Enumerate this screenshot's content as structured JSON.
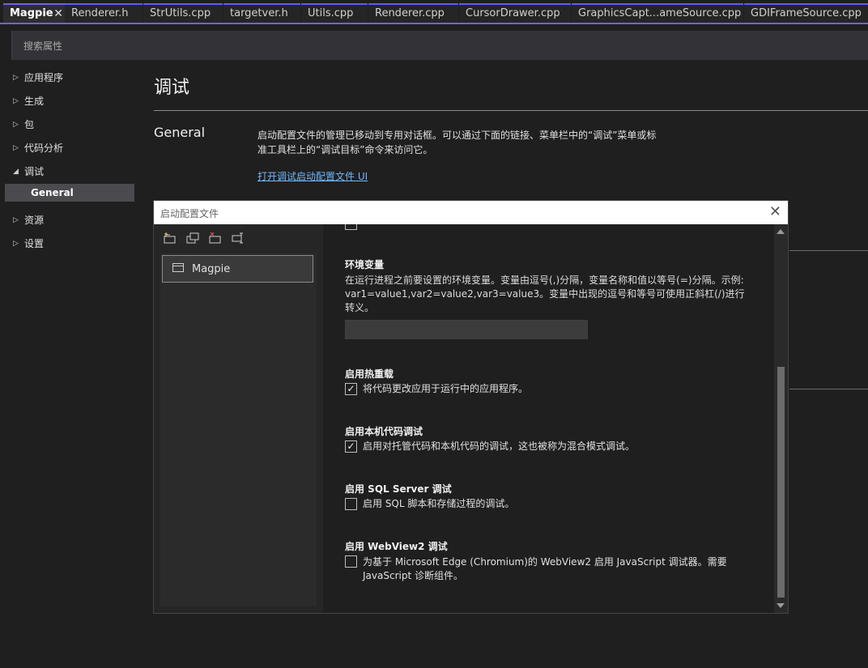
{
  "tabs": [
    {
      "label": "Magpie",
      "active": true
    },
    {
      "label": "Renderer.h"
    },
    {
      "label": "StrUtils.cpp"
    },
    {
      "label": "targetver.h"
    },
    {
      "label": "Utils.cpp"
    },
    {
      "label": "Renderer.cpp"
    },
    {
      "label": "CursorDrawer.cpp"
    },
    {
      "label": "GraphicsCapt...ameSource.cpp"
    },
    {
      "label": "GDIFrameSource.cpp"
    }
  ],
  "tab_close_glyph": "✕",
  "search": {
    "placeholder": "搜索属性"
  },
  "tree": {
    "items": [
      {
        "label": "应用程序",
        "arrow": "▷"
      },
      {
        "label": "生成",
        "arrow": "▷"
      },
      {
        "label": "包",
        "arrow": "▷"
      },
      {
        "label": "代码分析",
        "arrow": "▷"
      },
      {
        "label": "调试",
        "arrow": "◢"
      },
      {
        "label": "General"
      },
      {
        "label": "资源",
        "arrow": "▷"
      },
      {
        "label": "设置",
        "arrow": "▷"
      }
    ]
  },
  "page": {
    "title": "调试",
    "section": "General",
    "description": "启动配置文件的管理已移动到专用对话框。可以通过下面的链接、菜单栏中的“调试”菜单或标准工具栏上的“调试目标”命令来访问它。",
    "link": "打开调试启动配置文件 UI"
  },
  "dialog": {
    "title": "启动配置文件",
    "close_glyph": "✕",
    "profiles": [
      "Magpie"
    ],
    "options": {
      "env": {
        "heading": "环境变量",
        "description": "在运行进程之前要设置的环境变量。变量由逗号(,)分隔，变量名称和值以等号(=)分隔。示例: var1=value1,var2=value2,var3=value3。变量中出现的逗号和等号可使用正斜杠(/)进行转义。",
        "value": ""
      },
      "hot_reload": {
        "heading": "启用热重载",
        "label": "将代码更改应用于运行中的应用程序。",
        "checked": true
      },
      "native": {
        "heading": "启用本机代码调试",
        "label": "启用对托管代码和本机代码的调试，这也被称为混合模式调试。",
        "checked": true
      },
      "sql": {
        "heading": "启用 SQL Server 调试",
        "label": "启用 SQL 脚本和存储过程的调试。",
        "checked": false
      },
      "webview": {
        "heading": "启用 WebView2 调试",
        "label": "为基于 Microsoft Edge (Chromium)的 WebView2 启用 JavaScript 调试器。需要 JavaScript 诊断组件。",
        "checked": false
      }
    },
    "check_glyph": "✓"
  }
}
